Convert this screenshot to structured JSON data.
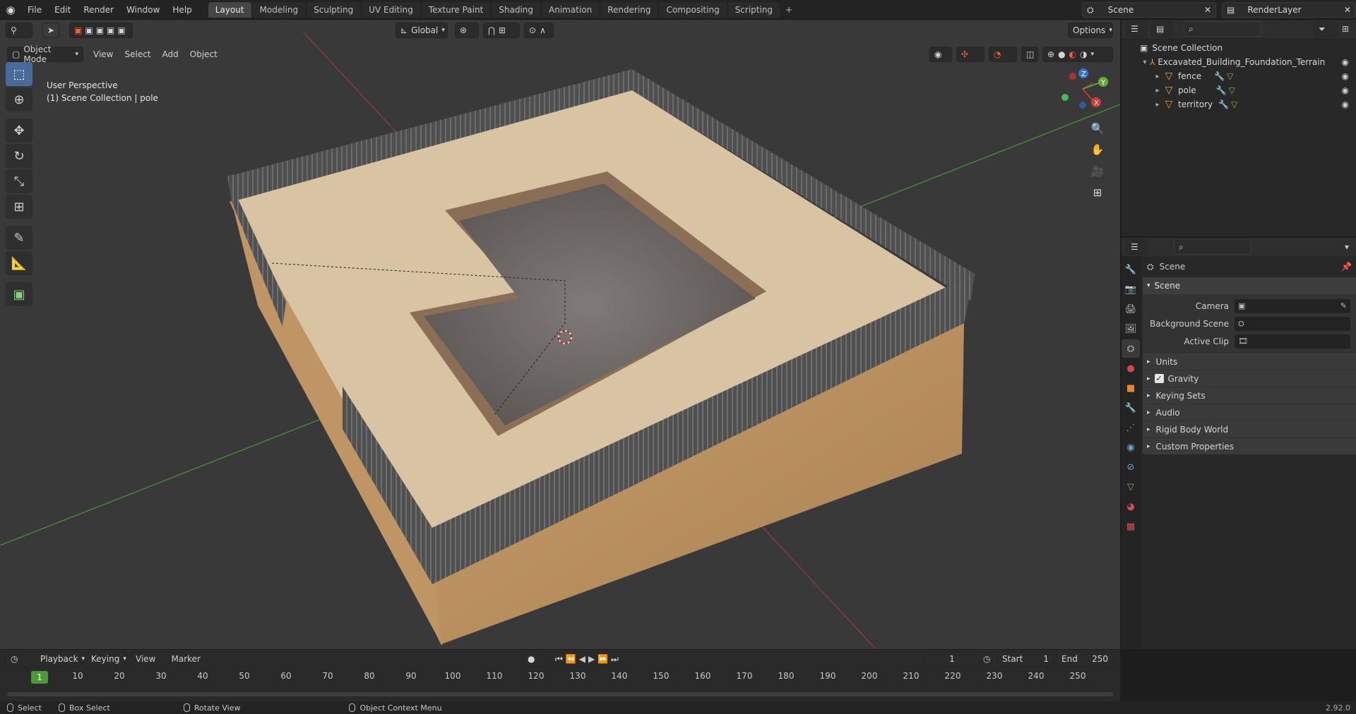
{
  "topbar": {
    "menu": [
      "File",
      "Edit",
      "Render",
      "Window",
      "Help"
    ],
    "workspaces": [
      "Layout",
      "Modeling",
      "Sculpting",
      "UV Editing",
      "Texture Paint",
      "Shading",
      "Animation",
      "Rendering",
      "Compositing",
      "Scripting"
    ],
    "active_workspace": "Layout",
    "add_tab": "+",
    "scene_name": "Scene",
    "view_layer": "RenderLayer"
  },
  "viewport": {
    "orientation": "Global",
    "options_label": "Options",
    "mode": "Object Mode",
    "menus": [
      "View",
      "Select",
      "Add",
      "Object"
    ],
    "info_line1": "User Perspective",
    "info_line2": "(1) Scene Collection | pole",
    "gizmo": {
      "x": "X",
      "y": "Y",
      "z": "Z"
    }
  },
  "outliner": {
    "root": "Scene Collection",
    "collection": "Excavated_Building_Foundation_Terrain",
    "objects": [
      "fence",
      "pole",
      "territory"
    ]
  },
  "properties": {
    "context": "Scene",
    "panel_title": "Scene",
    "camera_label": "Camera",
    "background_scene_label": "Background Scene",
    "active_clip_label": "Active Clip",
    "subpanels": [
      "Units",
      "Gravity",
      "Keying Sets",
      "Audio",
      "Rigid Body World",
      "Custom Properties"
    ],
    "gravity_checked": true
  },
  "timeline": {
    "menus": [
      "Playback",
      "Keying",
      "View",
      "Marker"
    ],
    "current_frame": "1",
    "start_label": "Start",
    "start": "1",
    "end_label": "End",
    "end": "250",
    "ruler": [
      "1",
      "10",
      "20",
      "30",
      "40",
      "50",
      "60",
      "70",
      "80",
      "90",
      "100",
      "110",
      "120",
      "130",
      "140",
      "150",
      "160",
      "170",
      "180",
      "190",
      "200",
      "210",
      "220",
      "230",
      "240",
      "250"
    ]
  },
  "statusbar": {
    "select": "Select",
    "box_select": "Box Select",
    "rotate_view": "Rotate View",
    "context_menu": "Object Context Menu",
    "version": "2.92.0"
  },
  "colors": {
    "accent": "#4a6b9a",
    "frame_green": "#4b9a3a",
    "object_orange": "#e89a3a",
    "sand": "#d9c1a0",
    "soil": "#c19a6b",
    "gravel": "#6e6a69"
  }
}
